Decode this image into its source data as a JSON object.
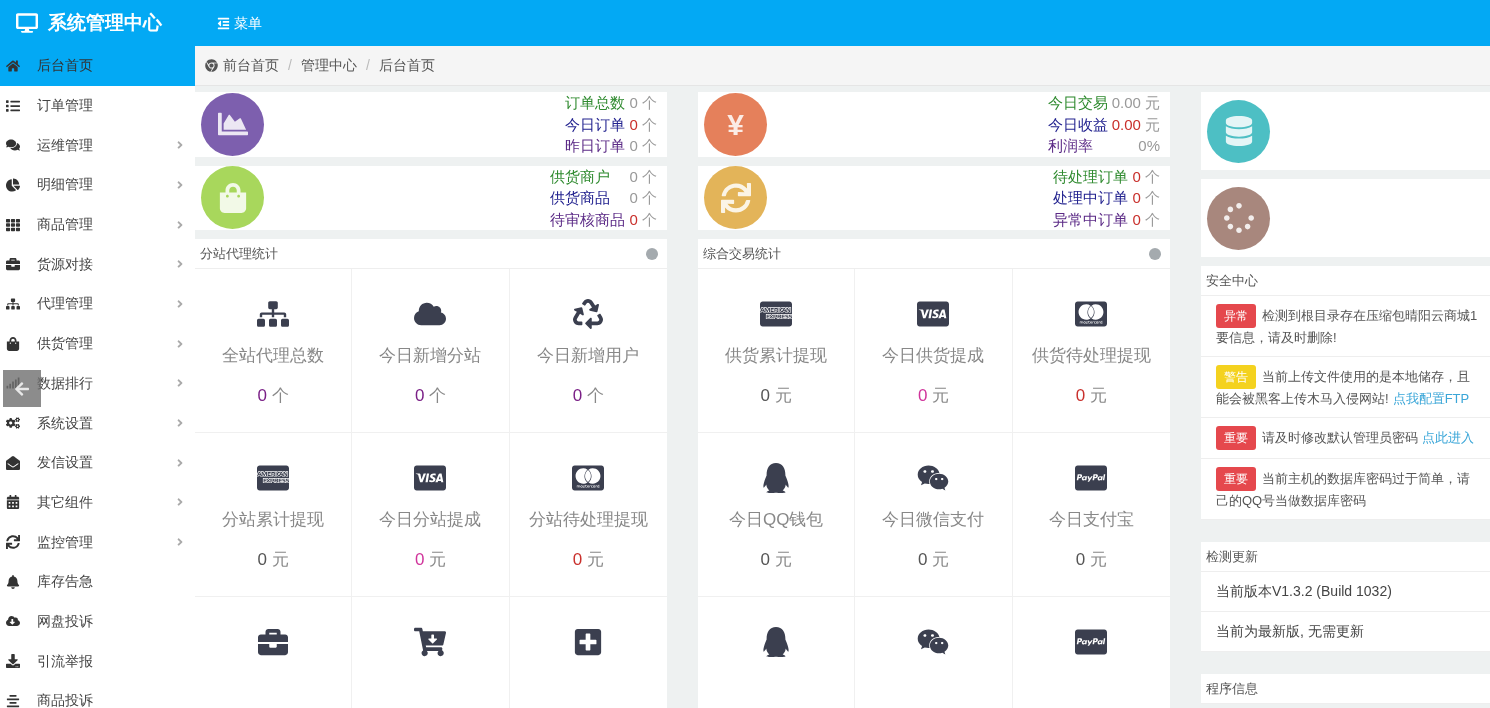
{
  "header": {
    "title": "系统管理中心",
    "menu_label": "菜单"
  },
  "sidebar": {
    "items": [
      {
        "label": "后台首页",
        "kind": "home",
        "selected": true,
        "has_submenu": false
      },
      {
        "label": "订单管理",
        "kind": "list",
        "selected": false,
        "has_submenu": false
      },
      {
        "label": "运维管理",
        "kind": "comments",
        "selected": false,
        "has_submenu": true
      },
      {
        "label": "明细管理",
        "kind": "pie",
        "selected": false,
        "has_submenu": true
      },
      {
        "label": "商品管理",
        "kind": "grid",
        "selected": false,
        "has_submenu": true
      },
      {
        "label": "货源对接",
        "kind": "briefcase",
        "selected": false,
        "has_submenu": true
      },
      {
        "label": "代理管理",
        "kind": "sitemap",
        "selected": false,
        "has_submenu": true
      },
      {
        "label": "供货管理",
        "kind": "bag",
        "selected": false,
        "has_submenu": true
      },
      {
        "label": "数据排行",
        "kind": "signal",
        "selected": false,
        "has_submenu": true
      },
      {
        "label": "系统设置",
        "kind": "cogs",
        "selected": false,
        "has_submenu": true
      },
      {
        "label": "发信设置",
        "kind": "envelope",
        "selected": false,
        "has_submenu": true
      },
      {
        "label": "其它组件",
        "kind": "calendar",
        "selected": false,
        "has_submenu": true
      },
      {
        "label": "监控管理",
        "kind": "sync",
        "selected": false,
        "has_submenu": true
      },
      {
        "label": "库存告急",
        "kind": "bell",
        "selected": false,
        "has_submenu": false
      },
      {
        "label": "网盘投诉",
        "kind": "cloud-download",
        "selected": false,
        "has_submenu": false
      },
      {
        "label": "引流举报",
        "kind": "download",
        "selected": false,
        "has_submenu": false
      },
      {
        "label": "商品投诉",
        "kind": "align",
        "selected": false,
        "has_submenu": false
      }
    ]
  },
  "breadcrumb": {
    "items": [
      "前台首页",
      "管理中心",
      "后台首页"
    ],
    "separators": [
      "/",
      "/"
    ]
  },
  "columns": [
    {
      "cards": [
        {
          "kind": "area-chart",
          "color": "#7d5fae",
          "rows": [
            {
              "label": "订单总数",
              "color": "#2e8a2e",
              "value": "0",
              "unit": "个",
              "alert": false
            },
            {
              "label": "今日订单",
              "color": "#22228f",
              "value": "0",
              "unit": "个",
              "alert": true
            },
            {
              "label": "昨日订单",
              "color": "#5b2a86",
              "value": "0",
              "unit": "个",
              "alert": false
            }
          ]
        },
        {
          "kind": "bag",
          "color": "#a8d75c",
          "rows": [
            {
              "label": "供货商户",
              "color": "#2e8a2e",
              "value": "0",
              "unit": "个",
              "alert": false
            },
            {
              "label": "供货商品",
              "color": "#22228f",
              "value": "0",
              "unit": "个",
              "alert": false
            },
            {
              "label": "待审核商品",
              "color": "#5b2a86",
              "value": "0",
              "unit": "个",
              "alert": true
            }
          ]
        }
      ],
      "panels": [
        {
          "kind": "tiles",
          "title": "分站代理统计",
          "tiles": [
            {
              "kind": "sitemap",
              "label": "全站代理总数",
              "value": "0",
              "unit": "个",
              "color": "#7a1f86"
            },
            {
              "kind": "cloud",
              "label": "今日新增分站",
              "value": "0",
              "unit": "个",
              "color": "#7a1f86"
            },
            {
              "kind": "recycle",
              "label": "今日新增用户",
              "value": "0",
              "unit": "个",
              "color": "#7a1f86"
            },
            {
              "kind": "amex",
              "label": "分站累计提现",
              "value": "0",
              "unit": "元",
              "color": "#555555"
            },
            {
              "kind": "visa",
              "label": "今日分站提成",
              "value": "0",
              "unit": "元",
              "color": "#d0349b"
            },
            {
              "kind": "mastercard",
              "label": "分站待处理提现",
              "value": "0",
              "unit": "元",
              "color": "#c9302c"
            },
            {
              "kind": "briefcase"
            },
            {
              "kind": "cart"
            },
            {
              "kind": "plus"
            }
          ]
        }
      ]
    },
    {
      "cards": [
        {
          "symbol": "¥",
          "color": "#e5805b",
          "rows": [
            {
              "label": "今日交易",
              "color": "#2e8a2e",
              "value": "0.00",
              "unit": "元",
              "alert": false
            },
            {
              "label": "今日收益",
              "color": "#22228f",
              "value": "0.00",
              "unit": "元",
              "alert": true
            },
            {
              "label": "利润率",
              "color": "#5b2a86",
              "value": "0%",
              "alert": false
            }
          ]
        },
        {
          "kind": "sync",
          "color": "#e3b459",
          "rows": [
            {
              "label": "待处理订单",
              "color": "#2e8a2e",
              "value": "0",
              "unit": "个",
              "alert": true
            },
            {
              "label": "处理中订单",
              "color": "#22228f",
              "value": "0",
              "unit": "个",
              "alert": true
            },
            {
              "label": "异常中订单",
              "color": "#5b2a86",
              "value": "0",
              "unit": "个",
              "alert": true
            }
          ]
        }
      ],
      "panels": [
        {
          "kind": "tiles",
          "title": "综合交易统计",
          "tiles": [
            {
              "kind": "amex",
              "label": "供货累计提现",
              "value": "0",
              "unit": "元",
              "color": "#555555"
            },
            {
              "kind": "visa",
              "label": "今日供货提成",
              "value": "0",
              "unit": "元",
              "color": "#d0349b"
            },
            {
              "kind": "mastercard",
              "label": "供货待处理提现",
              "value": "0",
              "unit": "元",
              "color": "#c9302c"
            },
            {
              "kind": "qq",
              "label": "今日QQ钱包",
              "value": "0",
              "unit": "元",
              "color": "#555555"
            },
            {
              "kind": "wechat",
              "label": "今日微信支付",
              "value": "0",
              "unit": "元",
              "color": "#555555"
            },
            {
              "kind": "paypal",
              "label": "今日支付宝",
              "value": "0",
              "unit": "元",
              "color": "#555555"
            },
            {
              "kind": "qq"
            },
            {
              "kind": "wechat"
            },
            {
              "kind": "paypal"
            }
          ]
        }
      ]
    },
    {
      "cards": [
        {
          "kind": "database",
          "color": "#4dbfc4"
        },
        {
          "kind": "spinner",
          "color": "#a8877d"
        }
      ],
      "panels": [
        {
          "kind": "alerts",
          "title": "安全中心",
          "alerts": [
            {
              "badge": "异常",
              "color": "#e5484d",
              "lines": [
                "检测到根目录存在压缩包晴阳云商城1",
                "要信息，请及时删除!"
              ]
            },
            {
              "badge": "警告",
              "color": "#f4d21f",
              "lines": [
                "当前上传文件使用的是本地储存，且",
                "能会被黑客上传木马入侵网站!"
              ],
              "link": "点我配置FTP"
            },
            {
              "badge": "重要",
              "color": "#e5484d",
              "lines": [
                "请及时修改默认管理员密码"
              ],
              "link": "点此进入"
            },
            {
              "badge": "重要",
              "color": "#e5484d",
              "lines": [
                "当前主机的数据库密码过于简单，请",
                "己的QQ号当做数据库密码"
              ]
            }
          ]
        },
        {
          "kind": "list",
          "title": "检测更新",
          "rows": [
            "当前版本V1.3.2 (Build 1032)",
            "当前为最新版, 无需更新"
          ]
        },
        {
          "kind": "list",
          "title": "程序信息"
        }
      ]
    }
  ]
}
